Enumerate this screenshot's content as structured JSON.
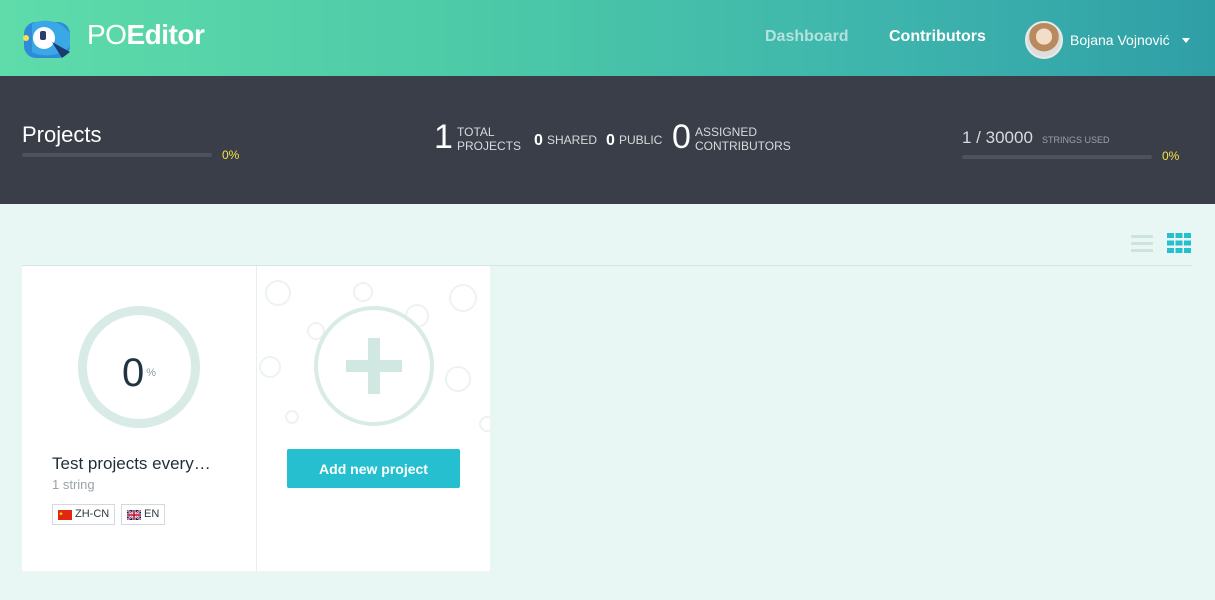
{
  "header": {
    "brand_po": "PO",
    "brand_editor": "Editor",
    "nav": {
      "dashboard": "Dashboard",
      "contributors": "Contributors"
    },
    "user_name": "Bojana Vojnović",
    "logo_icon": "parrot-logo-icon",
    "caret_icon": "chevron-down-icon"
  },
  "stats": {
    "title": "Projects",
    "projects_progress": "0%",
    "total_projects": "1",
    "total_label_1": "TOTAL",
    "total_label_2": "PROJECTS",
    "shared_count": "0",
    "shared_label": "SHARED",
    "public_count": "0",
    "public_label": "PUBLIC",
    "assigned_count": "0",
    "assigned_label_1": "ASSIGNED",
    "assigned_label_2": "CONTRIBUTORS",
    "strings_used": "1 / 30000",
    "strings_label": "STRINGS USED",
    "strings_progress": "0%"
  },
  "view": {
    "list_icon": "list-view-icon",
    "grid_icon": "grid-view-icon",
    "active": "grid"
  },
  "projects": [
    {
      "progress_value": "0",
      "progress_unit": "%",
      "name": "Test projects every…",
      "strings": "1 string",
      "languages": [
        {
          "code": "ZH-CN",
          "flag": "china-flag-icon"
        },
        {
          "code": "EN",
          "flag": "uk-flag-icon"
        }
      ]
    }
  ],
  "add_card": {
    "button_label": "Add new project",
    "icon": "plus-icon"
  },
  "colors": {
    "accent": "#26bfcf",
    "stats_bg": "#393e48",
    "progress_text": "#f7e24a",
    "page_bg": "#e8f7f3"
  }
}
